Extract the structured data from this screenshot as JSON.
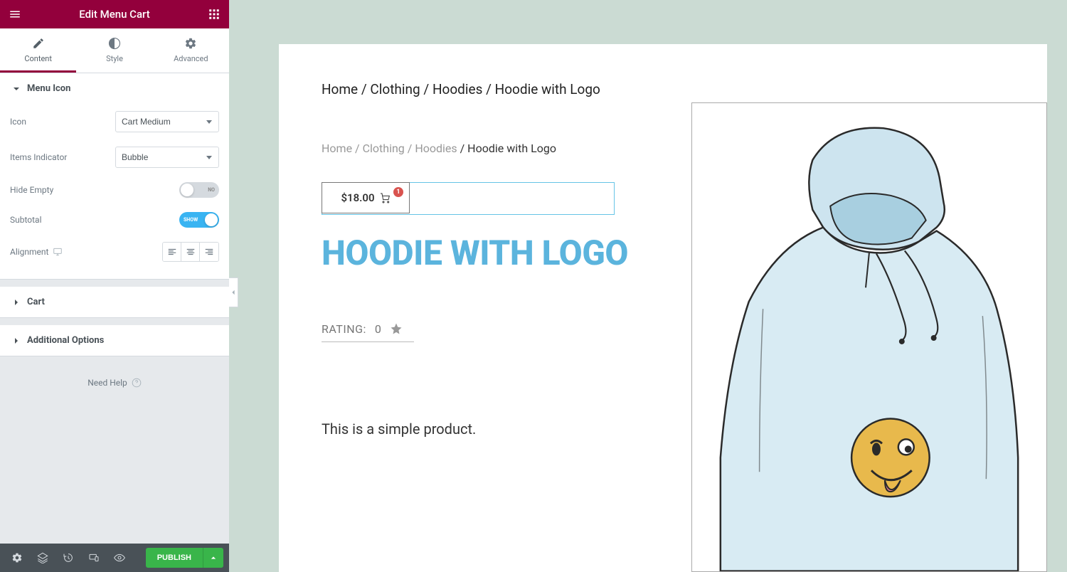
{
  "header": {
    "title": "Edit Menu Cart"
  },
  "tabs": {
    "content": "Content",
    "style": "Style",
    "advanced": "Advanced"
  },
  "sections": {
    "menu_icon": {
      "title": "Menu Icon",
      "icon": {
        "label": "Icon",
        "value": "Cart Medium"
      },
      "items_indicator": {
        "label": "Items Indicator",
        "value": "Bubble"
      },
      "hide_empty": {
        "label": "Hide Empty",
        "toggle_text": "NO"
      },
      "subtotal": {
        "label": "Subtotal",
        "toggle_text": "SHOW"
      },
      "alignment": {
        "label": "Alignment"
      }
    },
    "cart": {
      "title": "Cart"
    },
    "additional_options": {
      "title": "Additional Options"
    }
  },
  "need_help": "Need Help",
  "footer": {
    "publish": "PUBLISH"
  },
  "preview": {
    "breadcrumb1": "Home / Clothing / Hoodies / Hoodie with Logo",
    "breadcrumb2_links": "Home / Clothing / Hoodies",
    "breadcrumb2_current": " / Hoodie with Logo",
    "cart": {
      "price": "$18.00",
      "badge": "1"
    },
    "title": "HOODIE WITH LOGO",
    "rating": {
      "label": "RATING:",
      "value": "0"
    },
    "description": "This is a simple product."
  }
}
